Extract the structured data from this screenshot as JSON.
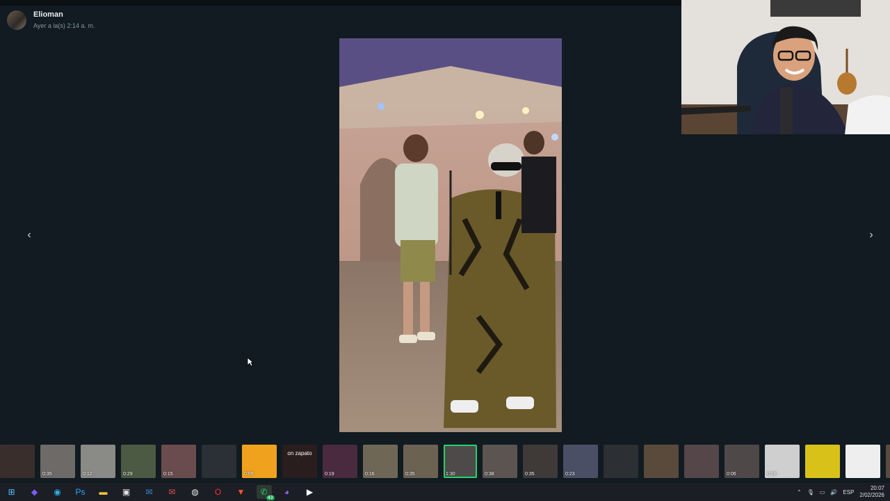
{
  "chat": {
    "sender": "Elioman",
    "timestamp": "Ayer a la(s) 2:14 a. m."
  },
  "viewer": {
    "prev_icon": "chevron-left-icon",
    "next_icon": "chevron-right-icon",
    "prev_glyph": "‹",
    "next_glyph": "›"
  },
  "thumbnails": [
    {
      "duration": "",
      "color": "#3a2e2c",
      "text": ""
    },
    {
      "duration": "0:35",
      "color": "#6e6a68",
      "text": ""
    },
    {
      "duration": "0:12",
      "color": "#8a8a86",
      "text": ""
    },
    {
      "duration": "0:29",
      "color": "#4c5a44",
      "text": ""
    },
    {
      "duration": "0:15",
      "color": "#6a4c4e",
      "text": ""
    },
    {
      "duration": "",
      "color": "#2b2f36",
      "text": ""
    },
    {
      "duration": "0:09",
      "color": "#f0a21f",
      "text": ""
    },
    {
      "duration": "",
      "color": "#2a1d1e",
      "text": "on zapato"
    },
    {
      "duration": "0:19",
      "color": "#4a2a3e",
      "text": ""
    },
    {
      "duration": "0:16",
      "color": "#6f6756",
      "text": ""
    },
    {
      "duration": "0:35",
      "color": "#6b6252",
      "text": ""
    },
    {
      "duration": "1:30",
      "color": "#4e4a4a",
      "text": ""
    },
    {
      "duration": "0:38",
      "color": "#5b5450",
      "text": ""
    },
    {
      "duration": "0:35",
      "color": "#3f3a38",
      "text": ""
    },
    {
      "duration": "0:23",
      "color": "#4a4f66",
      "text": ""
    },
    {
      "duration": "",
      "color": "#2c3034",
      "text": ""
    },
    {
      "duration": "",
      "color": "#5a4a3c",
      "text": ""
    },
    {
      "duration": "",
      "color": "#55464a",
      "text": ""
    },
    {
      "duration": "0:06",
      "color": "#4e4848",
      "text": ""
    },
    {
      "duration": "0:28",
      "color": "#cfcfcf",
      "text": ""
    },
    {
      "duration": "",
      "color": "#d8c21a",
      "text": ""
    },
    {
      "duration": "",
      "color": "#eeeeee",
      "text": ""
    },
    {
      "duration": "",
      "color": "#5a4a40",
      "text": ""
    }
  ],
  "selected_thumbnail_index": 11,
  "taskbar": {
    "icons": [
      {
        "name": "windows-start-icon",
        "glyph": "⊞",
        "color": "#4cc2ff"
      },
      {
        "name": "copilot-icon",
        "glyph": "◆",
        "color": "#7b5cff"
      },
      {
        "name": "edge-browser-icon",
        "glyph": "◉",
        "color": "#2fb0e8"
      },
      {
        "name": "photoshop-icon",
        "glyph": "Ps",
        "color": "#31a8ff"
      },
      {
        "name": "file-explorer-icon",
        "glyph": "▬",
        "color": "#f5c242"
      },
      {
        "name": "microsoft-store-icon",
        "glyph": "▣",
        "color": "#e0e0e0"
      },
      {
        "name": "outlook-icon",
        "glyph": "✉",
        "color": "#2f8ae0"
      },
      {
        "name": "mail-icon",
        "glyph": "✉",
        "color": "#e05050"
      },
      {
        "name": "chrome-icon",
        "glyph": "◍",
        "color": "#e8e8e8"
      },
      {
        "name": "opera-icon",
        "glyph": "O",
        "color": "#ff2a3a"
      },
      {
        "name": "brave-icon",
        "glyph": "▼",
        "color": "#fb542b"
      },
      {
        "name": "whatsapp-icon",
        "glyph": "✆",
        "color": "#25d366"
      },
      {
        "name": "messenger-icon",
        "glyph": "◕",
        "color": "#a05cff"
      },
      {
        "name": "media-player-icon",
        "glyph": "▶",
        "color": "#ffffff"
      }
    ],
    "whatsapp_badge": "43"
  },
  "tray": {
    "language": "ESP",
    "time": "20:07",
    "date": "2/02/2026"
  }
}
